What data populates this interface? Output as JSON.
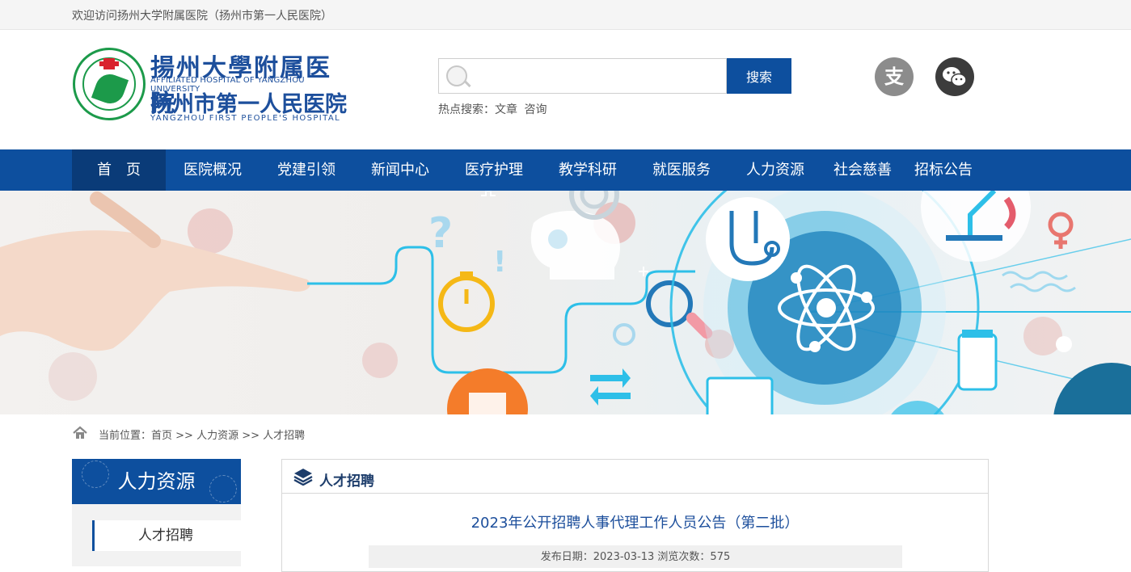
{
  "topbar": {
    "welcome": "欢迎访问扬州大学附属医院（扬州市第一人民医院）"
  },
  "logo": {
    "cn_name_1": "揚州大學附属医院",
    "en_name_1": "AFFILIATED HOSPITAL OF YANGZHOU UNIVERSITY",
    "cn_name_2": "扬州市第一人民医院",
    "en_name_2": "YANGZHOU FIRST PEOPLE'S HOSPITAL"
  },
  "search": {
    "value": "",
    "button_label": "搜索",
    "hot_label": "热点搜索：",
    "hot_terms": [
      "文章",
      "咨询"
    ]
  },
  "social": {
    "alipay_glyph": "支"
  },
  "nav": {
    "items": [
      {
        "label": "首　页",
        "active": true
      },
      {
        "label": "医院概况"
      },
      {
        "label": "党建引领"
      },
      {
        "label": "新闻中心"
      },
      {
        "label": "医疗护理"
      },
      {
        "label": "教学科研"
      },
      {
        "label": "就医服务"
      },
      {
        "label": "人力资源"
      },
      {
        "label": "社会慈善"
      },
      {
        "label": "招标公告"
      }
    ]
  },
  "breadcrumb": {
    "prefix": "当前位置：",
    "items": [
      "首页",
      "人力资源",
      "人才招聘"
    ],
    "separator": " >> "
  },
  "sidebar": {
    "title": "人力资源",
    "items": [
      "人才招聘"
    ]
  },
  "panel": {
    "title": "人才招聘",
    "article_title": "2023年公开招聘人事代理工作人员公告（第二批）",
    "meta": "发布日期：2023-03-13 浏览次数：575"
  },
  "colors": {
    "brand_blue": "#0d4f9e",
    "nav_active": "#0a3b78",
    "logo_green": "#1c9a4a",
    "logo_red": "#d9232e"
  }
}
